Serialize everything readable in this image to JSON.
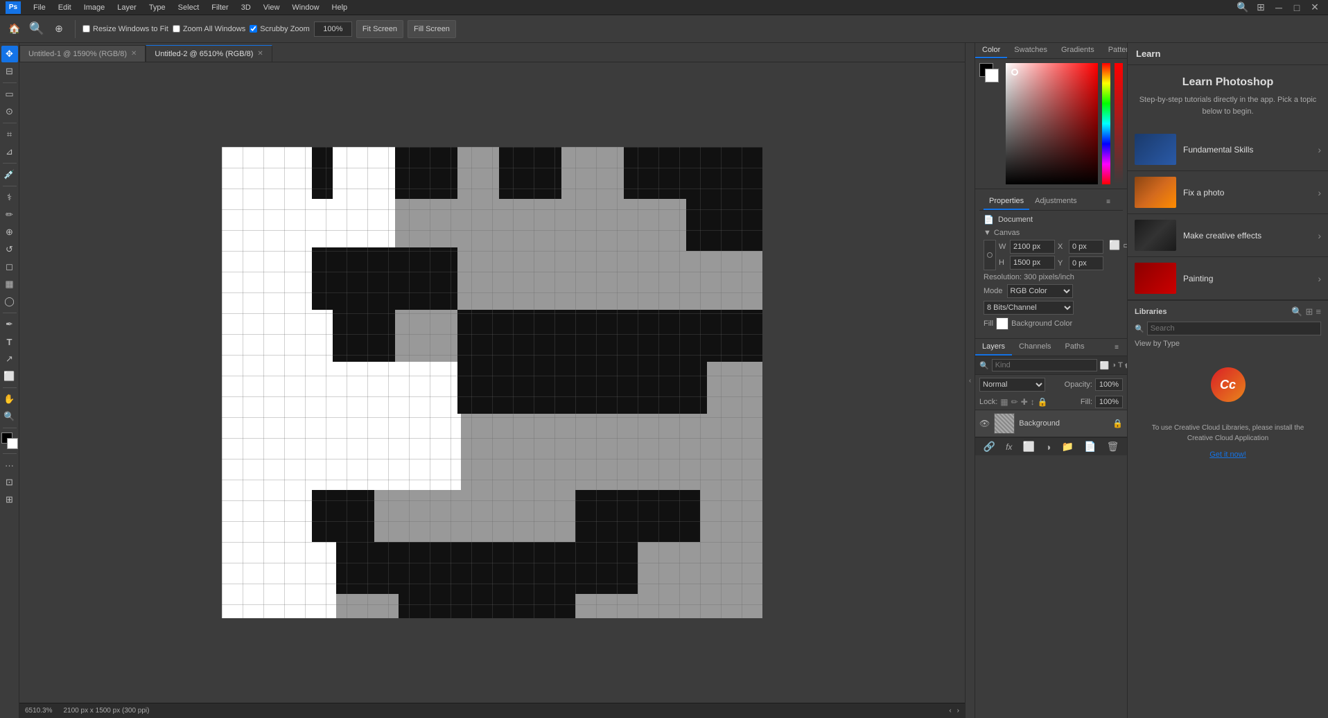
{
  "menubar": {
    "logo": "Ps",
    "items": [
      "File",
      "Edit",
      "Image",
      "Layer",
      "Type",
      "Select",
      "Filter",
      "3D",
      "View",
      "Window",
      "Help"
    ]
  },
  "toolbar": {
    "resize_windows_label": "Resize Windows to Fit",
    "zoom_all_label": "Zoom All Windows",
    "scrubby_zoom_label": "Scrubby Zoom",
    "zoom_level": "100%",
    "fit_screen_label": "Fit Screen",
    "fill_screen_label": "Fill Screen"
  },
  "tabs": [
    {
      "label": "Untitled-1 @ 1590% (RGB/8)",
      "active": false,
      "closable": true
    },
    {
      "label": "Untitled-2 @ 6510% (RGB/8)",
      "active": true,
      "closable": true
    }
  ],
  "color_panel": {
    "tabs": [
      "Color",
      "Swatches",
      "Gradients",
      "Patterns"
    ],
    "active_tab": "Color"
  },
  "properties_panel": {
    "tabs": [
      "Properties",
      "Adjustments"
    ],
    "active_tab": "Properties",
    "doc_label": "Document",
    "canvas_label": "Canvas",
    "width_label": "W",
    "width_value": "2100 px",
    "height_label": "H",
    "height_value": "1500 px",
    "x_label": "X",
    "x_value": "0 px",
    "y_label": "Y",
    "y_value": "0 px",
    "resolution_label": "Resolution:",
    "resolution_value": "300 pixels/inch",
    "mode_label": "Mode",
    "mode_value": "RGB Color",
    "bit_depth_value": "8 Bits/Channel",
    "fill_label": "Fill",
    "fill_value": "Background Color"
  },
  "layers_panel": {
    "tabs": [
      "Layers",
      "Channels",
      "Paths"
    ],
    "active_tab": "Layers",
    "search_placeholder": "Kind",
    "blend_mode": "Normal",
    "opacity_label": "Opacity:",
    "opacity_value": "100%",
    "fill_label": "Fill:",
    "fill_value": "100%",
    "lock_label": "Lock:",
    "layers": [
      {
        "name": "Background",
        "visible": true,
        "locked": true,
        "thumb_color": "#888"
      }
    ]
  },
  "learn_panel": {
    "header_label": "Learn",
    "title": "Learn Photoshop",
    "subtitle": "Step-by-step tutorials directly in the app. Pick a topic below to begin.",
    "items": [
      {
        "label": "Fundamental Skills",
        "thumb_class": "thumb-blue"
      },
      {
        "label": "Fix a photo",
        "thumb_class": "thumb-orange"
      },
      {
        "label": "Make creative effects",
        "thumb_class": "thumb-dark"
      },
      {
        "label": "Painting",
        "thumb_class": "thumb-red"
      }
    ]
  },
  "libraries": {
    "header": "Libraries",
    "view_by_type": "View by Type",
    "cc_msg": "To use Creative Cloud Libraries, please install the Creative Cloud Application",
    "get_link": "Get it now!"
  },
  "statusbar": {
    "zoom": "6510.3%",
    "dimensions": "2100 px x 1500 px (300 ppi)"
  },
  "icons": {
    "move": "✥",
    "marquee": "▭",
    "lasso": "⊙",
    "crop": "⌗",
    "eyedropper": "✒",
    "healing": "⚕",
    "brush": "✏",
    "clone": "⊕",
    "eraser": "◻",
    "gradient": "▦",
    "dodge": "◯",
    "pen": "✒",
    "type": "T",
    "path": "↗",
    "shape": "◻",
    "hand": "✋",
    "zoom": "🔍",
    "foreground": "■",
    "background": "□"
  }
}
